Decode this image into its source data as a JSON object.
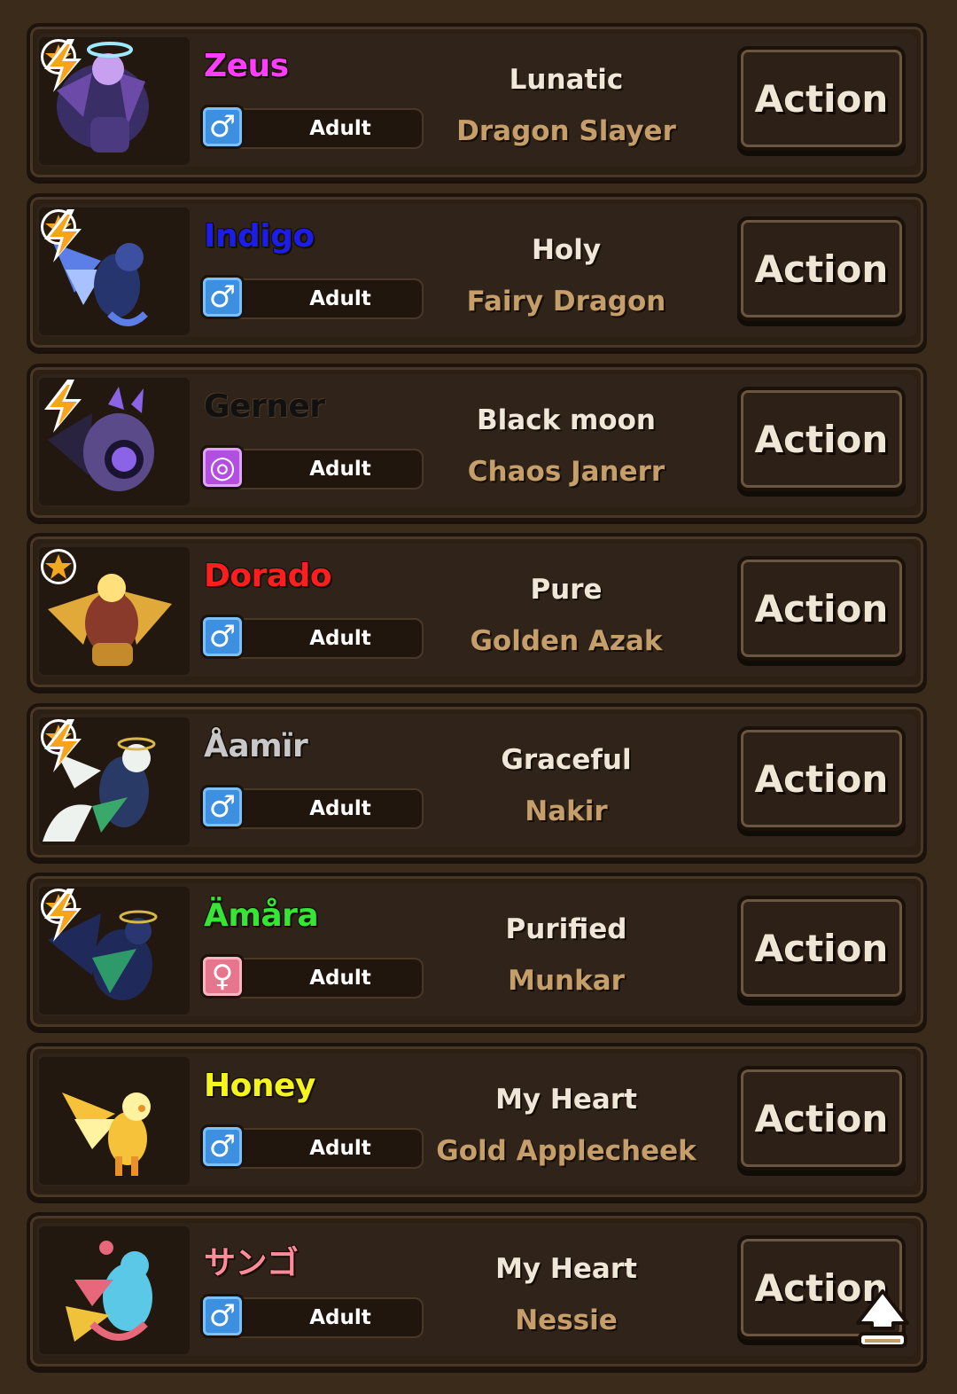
{
  "dragons": [
    {
      "name": "Zeus",
      "name_color": "#ff3dff",
      "starred": true,
      "charged": true,
      "gender_icon": "male-symbol-icon",
      "gender_glyph": "♂",
      "gender_style": "male",
      "age": "Adult",
      "trait": "Lunatic",
      "species": "Dragon Slayer",
      "action": "Action",
      "art_colors": [
        "#6b4aa8",
        "#3a2e66",
        "#c8a0f0"
      ]
    },
    {
      "name": "Indigo",
      "name_color": "#1d1de8",
      "starred": true,
      "charged": true,
      "gender_icon": "male-symbol-icon",
      "gender_glyph": "♂",
      "gender_style": "male",
      "age": "Adult",
      "trait": "Holy",
      "species": "Fairy Dragon",
      "action": "Action",
      "art_colors": [
        "#5b7fe6",
        "#27356e",
        "#a7c2ff"
      ]
    },
    {
      "name": "Gerner",
      "name_color": "#111111",
      "starred": false,
      "charged": true,
      "gender_icon": "genderless-symbol-icon",
      "gender_glyph": "◎",
      "gender_style": "none",
      "age": "Adult",
      "trait": "Black moon",
      "species": "Chaos Janerr",
      "action": "Action",
      "art_colors": [
        "#5a4a8a",
        "#2a2340",
        "#8a63e6"
      ]
    },
    {
      "name": "Dorado",
      "name_color": "#ff1e1e",
      "starred": true,
      "charged": false,
      "gender_icon": "male-symbol-icon",
      "gender_glyph": "♂",
      "gender_style": "male",
      "age": "Adult",
      "trait": "Pure",
      "species": "Golden Azak",
      "action": "Action",
      "art_colors": [
        "#e0a93a",
        "#8a3a2a",
        "#ffe07a"
      ]
    },
    {
      "name": "Åamïr",
      "name_color": "#c8c8c8",
      "starred": true,
      "charged": true,
      "gender_icon": "male-symbol-icon",
      "gender_glyph": "♂",
      "gender_style": "male",
      "age": "Adult",
      "trait": "Graceful",
      "species": "Nakir",
      "action": "Action",
      "art_colors": [
        "#eef2ee",
        "#3aa86a",
        "#2a3a66"
      ]
    },
    {
      "name": "Ämåra",
      "name_color": "#35e635",
      "starred": true,
      "charged": true,
      "gender_icon": "female-symbol-icon",
      "gender_glyph": "♀",
      "gender_style": "female",
      "age": "Adult",
      "trait": "Purified",
      "species": "Munkar",
      "action": "Action",
      "art_colors": [
        "#1f2a5a",
        "#2e9a6a",
        "#d8b84a"
      ]
    },
    {
      "name": "Honey",
      "name_color": "#f5f51e",
      "starred": false,
      "charged": false,
      "gender_icon": "male-symbol-icon",
      "gender_glyph": "♂",
      "gender_style": "male",
      "age": "Adult",
      "trait": "My Heart",
      "species": "Gold Applecheek",
      "action": "Action",
      "art_colors": [
        "#f5c23a",
        "#e8902a",
        "#fff2a0"
      ]
    },
    {
      "name": "サンゴ",
      "name_color": "#ff8a9a",
      "starred": false,
      "charged": false,
      "gender_icon": "male-symbol-icon",
      "gender_glyph": "♂",
      "gender_style": "male",
      "age": "Adult",
      "trait": "My Heart",
      "species": "Nessie",
      "action": "Action",
      "art_colors": [
        "#5ac8e6",
        "#e6687a",
        "#f0c23a"
      ]
    }
  ]
}
